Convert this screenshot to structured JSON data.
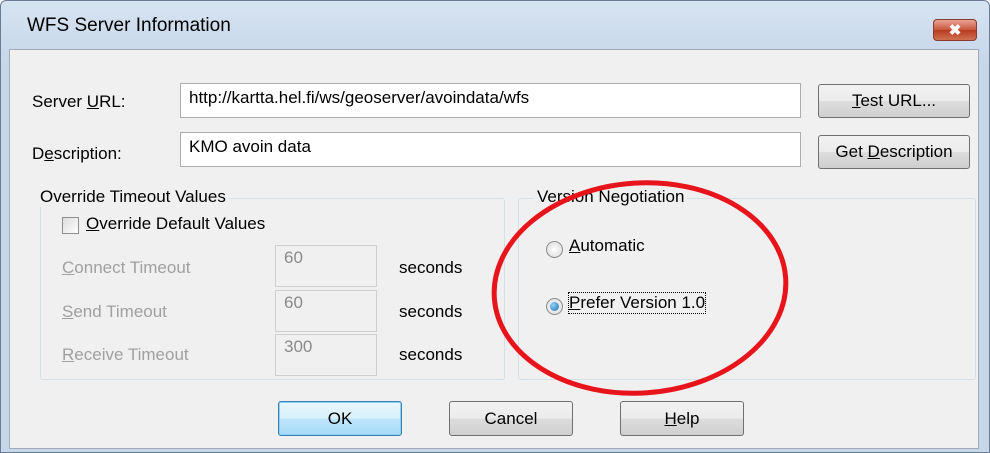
{
  "window": {
    "title": "WFS Server Information",
    "close_glyph": "✖"
  },
  "server_url": {
    "label_pre": "Server ",
    "label_mnemonic": "U",
    "label_post": "RL:",
    "value": "http://kartta.hel.fi/ws/geoserver/avoindata/wfs"
  },
  "description": {
    "label_pre": "D",
    "label_mnemonic": "e",
    "label_post": "scription:",
    "value": "KMO avoin data"
  },
  "buttons": {
    "test_url": {
      "mnemonic": "T",
      "rest": "est URL..."
    },
    "get_description": {
      "pre": "Get ",
      "mnemonic": "D",
      "rest": "escription"
    },
    "ok": "OK",
    "cancel": "Cancel",
    "help": {
      "mnemonic": "H",
      "rest": "elp"
    }
  },
  "timeout_group": {
    "title": "Override Timeout Values",
    "override_checkbox": {
      "mnemonic": "O",
      "rest": "verride Default Values",
      "checked": false
    },
    "rows": [
      {
        "mnemonic": "C",
        "rest": "onnect Timeout",
        "value": "60",
        "unit": "seconds"
      },
      {
        "mnemonic": "S",
        "rest": "end Timeout",
        "value": "60",
        "unit": "seconds"
      },
      {
        "mnemonic": "R",
        "rest": "eceive Timeout",
        "value": "300",
        "unit": "seconds"
      }
    ]
  },
  "version_group": {
    "title": "Version Negotiation",
    "options": [
      {
        "mnemonic": "A",
        "rest": "utomatic",
        "selected": false
      },
      {
        "mnemonic": "P",
        "rest": "refer Version 1.0",
        "selected": true
      }
    ]
  },
  "colors": {
    "annotation_ellipse": "#e8141c",
    "accent": "#3c7fb1"
  }
}
